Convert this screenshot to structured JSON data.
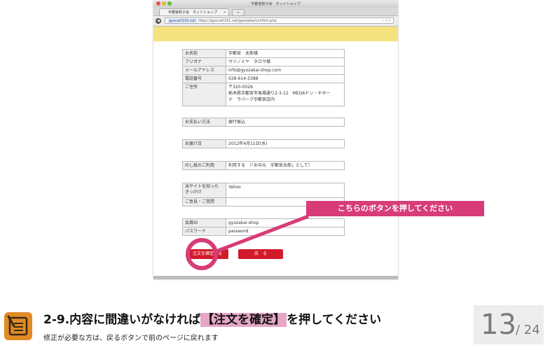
{
  "browser": {
    "window_title": "宇都宮餃子会　ネットショップ",
    "tab_label": "宇都宮餃子会　ネットショップ",
    "tab_close": "×",
    "new_tab": "+",
    "url_host": "gyocart101.net",
    "url_rest": "https://gyocart101.net/gyozakai/confirm.php",
    "star": "☆ ▾ C"
  },
  "customer": [
    {
      "label": "お名前",
      "value": "宇都宮　太郎様"
    },
    {
      "label": "フリガナ",
      "value": "ウツノミヤ　タロウ様"
    },
    {
      "label": "メールアドレス",
      "value": "info@gyozakai-shop.com"
    },
    {
      "label": "電話番号",
      "value": "028-614-5388"
    },
    {
      "label": "ご住所",
      "value": "〒320-0026",
      "value2": "栃木県宇都宮市馬場通り2-3-12　MEGAドン・キホー",
      "value3": "テ　ラパーク宇都宮店内"
    }
  ],
  "payment": {
    "label": "お支払い方法",
    "value": "銀行振込"
  },
  "delivery": {
    "label": "お届け日",
    "value": "2012年4月11日(水)"
  },
  "noshi": {
    "label": "のし紙のご利用",
    "value": "利用する　（「お中元　宇都宮太郎」として）"
  },
  "survey": [
    {
      "label": "当サイトを知った\nきっかけ",
      "value": "Yahoo"
    },
    {
      "label": "ご意見・ご質問",
      "value": ""
    }
  ],
  "member": [
    {
      "label": "会員ID",
      "value": "gyozakai-shop"
    },
    {
      "label": "パスワード",
      "value": "password"
    }
  ],
  "buttons": {
    "confirm": "注文を確定する",
    "back": "戻　る"
  },
  "callout": "こちらのボタンを押してください",
  "slide": {
    "heading_pre": "2-9.内容に間違いがなければ",
    "heading_highlight": "【注文を確定】",
    "heading_post": "を押してください",
    "subtitle": "修正が必要な方は、戻るボタンで前のページに戻れます",
    "page_current": "13",
    "page_total": "/ 24"
  }
}
